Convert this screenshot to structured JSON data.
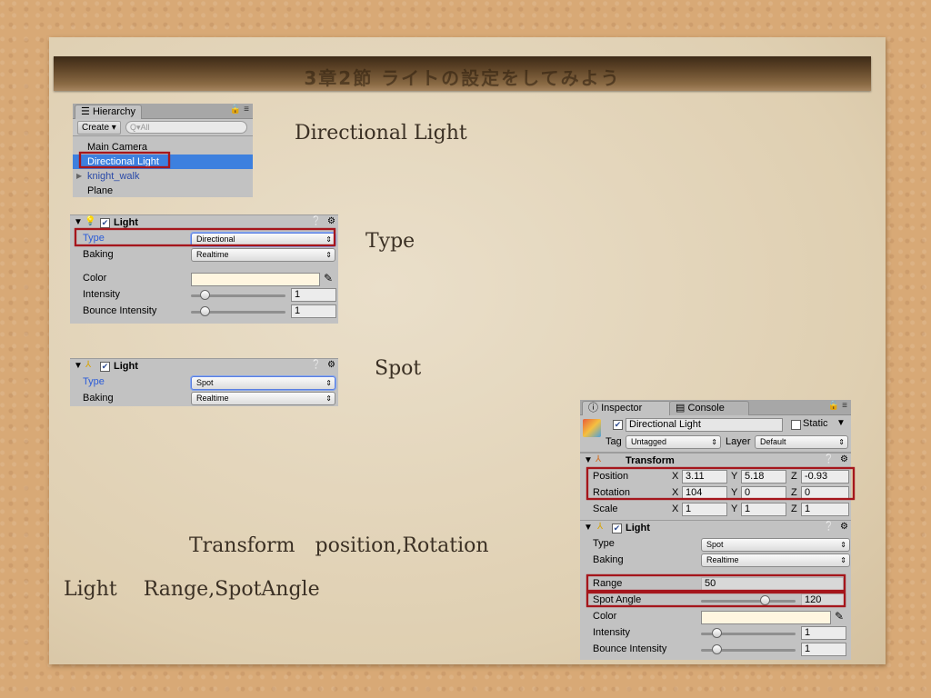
{
  "slide": {
    "banner_title": "3章2節 ライトの設定をしてみよう",
    "caption_directional": "Directional Light",
    "caption_type": "Type",
    "caption_spot": "Spot",
    "caption_transform": "Transform　position,Rotation",
    "caption_light": "Light　 Range,SpotAngle"
  },
  "hierarchy": {
    "tab": "Hierarchy",
    "create": "Create ▾",
    "search_placeholder": "Q▾All",
    "items": [
      "Main Camera",
      "Directional Light",
      "knight_walk",
      "Plane"
    ]
  },
  "light_panel_1": {
    "header": "Light",
    "type_label": "Type",
    "type_value": "Directional",
    "baking_label": "Baking",
    "baking_value": "Realtime",
    "color_label": "Color",
    "color_value": "#fff6e0",
    "intensity_label": "Intensity",
    "intensity_value": "1",
    "bounce_label": "Bounce Intensity",
    "bounce_value": "1"
  },
  "light_panel_2": {
    "header": "Light",
    "type_label": "Type",
    "type_value": "Spot",
    "baking_label": "Baking",
    "baking_value": "Realtime"
  },
  "inspector": {
    "tab_inspector": "Inspector",
    "tab_console": "Console",
    "object_name": "Directional Light",
    "static_label": "Static",
    "tag_label": "Tag",
    "tag_value": "Untagged",
    "layer_label": "Layer",
    "layer_value": "Default",
    "transform": {
      "header": "Transform",
      "position_label": "Position",
      "position": {
        "x": "3.11",
        "y": "5.18",
        "z": "-0.93"
      },
      "rotation_label": "Rotation",
      "rotation": {
        "x": "104",
        "y": "0",
        "z": "0"
      },
      "scale_label": "Scale",
      "scale": {
        "x": "1",
        "y": "1",
        "z": "1"
      },
      "axis_x": "X",
      "axis_y": "Y",
      "axis_z": "Z"
    },
    "light": {
      "header": "Light",
      "type_label": "Type",
      "type_value": "Spot",
      "baking_label": "Baking",
      "baking_value": "Realtime",
      "range_label": "Range",
      "range_value": "50",
      "spot_angle_label": "Spot Angle",
      "spot_angle_value": "120",
      "color_label": "Color",
      "color_value": "#fff6e0",
      "intensity_label": "Intensity",
      "intensity_value": "1",
      "bounce_label": "Bounce Intensity",
      "bounce_value": "1"
    }
  },
  "colors": {
    "highlight_red": "#a5161c",
    "selection_blue": "#3d80df",
    "label_blue": "#2b5cd8"
  }
}
